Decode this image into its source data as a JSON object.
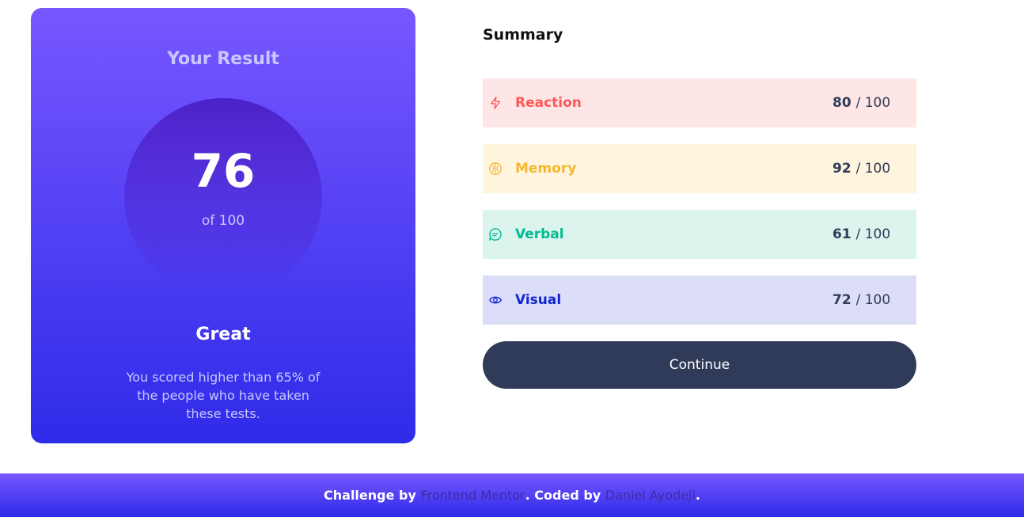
{
  "result": {
    "title": "Your Result",
    "score": "76",
    "score_of": "of 100",
    "rating": "Great",
    "description": "You scored higher than 65% of the people who have taken these tests."
  },
  "summary": {
    "title": "Summary",
    "items": [
      {
        "label": "Reaction",
        "score": "80",
        "total": "/ 100",
        "icon": "lightning-icon",
        "color": "#ff5757",
        "bg": "#ffe6e6"
      },
      {
        "label": "Memory",
        "score": "92",
        "total": "/ 100",
        "icon": "brain-icon",
        "color": "#f5b82d",
        "bg": "#fff4de"
      },
      {
        "label": "Verbal",
        "score": "61",
        "total": "/ 100",
        "icon": "chat-icon",
        "color": "#00bb8f",
        "bg": "#dbf4ee"
      },
      {
        "label": "Visual",
        "score": "72",
        "total": "/ 100",
        "icon": "eye-icon",
        "color": "#1125d6",
        "bg": "#dcddf7"
      }
    ],
    "continue_label": "Continue"
  },
  "footer": {
    "prefix": "Challenge by",
    "challenge_link": "Frontend Mentor",
    "middle": ". Coded by",
    "author_link": "Daniel Ayodeji",
    "suffix": "."
  },
  "colors": {
    "gradient_start": "#7857ff",
    "gradient_end": "#2e2be9",
    "button": "#303b5a"
  }
}
